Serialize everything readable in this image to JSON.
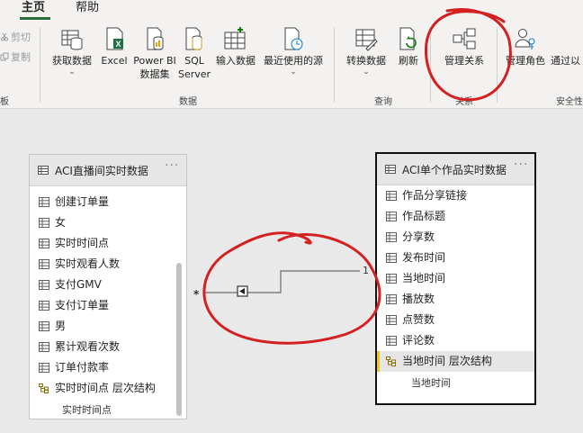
{
  "tabs": {
    "home": "主页",
    "help": "帮助"
  },
  "clipboard": {
    "cut": "剪切",
    "copy": "复制",
    "group_fragment": "板"
  },
  "ribbon": {
    "get_data": "获取数据",
    "excel": "Excel",
    "powerbi_line1": "Power BI",
    "powerbi_line2": "数据集",
    "sql_line1": "SQL",
    "sql_line2": "Server",
    "enter_data": "输入数据",
    "recent_sources": "最近使用的源",
    "group_data": "数据",
    "transform": "转换数据",
    "refresh": "刷新",
    "group_query": "查询",
    "manage_rel": "管理关系",
    "group_rel_fragment": "关系",
    "manage_roles": "管理角色",
    "view_as": "通过以",
    "group_security_fragment": "安全性"
  },
  "table_a": {
    "title": "ACI直播间实时数据",
    "more": "···",
    "fields": [
      "创建订单量",
      "女",
      "实时时间点",
      "实时观看人数",
      "支付GMV",
      "支付订单量",
      "男",
      "累计观看次数",
      "订单付款率"
    ],
    "hierarchy": "实时时间点 层次结构",
    "hierarchy_child": "实时时间点"
  },
  "table_b": {
    "title": "ACI单个作品实时数据",
    "more": "···",
    "fields": [
      "作品分享链接",
      "作品标题",
      "分享数",
      "发布时间",
      "当地时间",
      "播放数",
      "点赞数",
      "评论数"
    ],
    "hierarchy": "当地时间 层次结构",
    "hierarchy_child": "当地时间"
  },
  "relationship": {
    "many": "*",
    "one": "1"
  },
  "colors": {
    "accent_green": "#2c6e3a",
    "annotation_red": "#d42020",
    "hierarchy_yellow": "#f2c811"
  }
}
